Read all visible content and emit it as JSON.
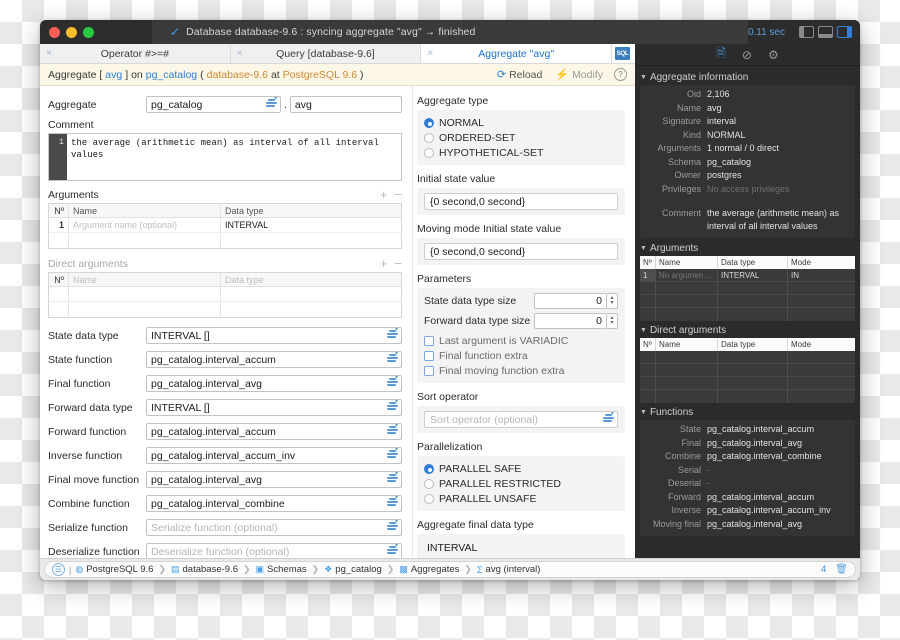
{
  "window": {
    "titlebar": {
      "status_icon": "check-icon",
      "status_text": "Database database-9.6 : syncing aggregate \"avg\" → finished",
      "elapsed": "0.11 sec"
    }
  },
  "tabs": [
    {
      "label": "Operator #>=#",
      "active": false,
      "close": "×"
    },
    {
      "label": "Query [database-9.6]",
      "active": false,
      "close": "×"
    },
    {
      "label": "Aggregate \"avg\"",
      "active": true,
      "close": "×",
      "badge": "SQL"
    }
  ],
  "subheader": {
    "prefix": "Aggregate [ ",
    "object": "avg",
    "mid": " ] on ",
    "schema": "pg_catalog",
    "paren_open": " (",
    "database": "database-9.6",
    "at": " at ",
    "server": "PostgreSQL 9.6",
    "paren_close": ")",
    "reload": "Reload",
    "modify": "Modify",
    "help": "?"
  },
  "form": {
    "aggregate_label": "Aggregate",
    "aggregate_schema": "pg_catalog",
    "dot": ".",
    "aggregate_name": "avg",
    "comment_label": "Comment",
    "comment_line_no": "1",
    "comment_text": "the average (arithmetic mean) as interval of all interval\nvalues",
    "arguments": {
      "title": "Arguments",
      "add": "+",
      "remove": "−",
      "columns": [
        "Nº",
        "Name",
        "Data type"
      ],
      "rows": [
        {
          "num": "1",
          "name_placeholder": "Argument name (optional)",
          "data_type": "INTERVAL"
        },
        {
          "num": "",
          "name_placeholder": "",
          "data_type": ""
        }
      ]
    },
    "direct_arguments": {
      "title": "Direct arguments",
      "add": "+",
      "remove": "−",
      "columns": [
        "Nº",
        "Name",
        "Data type"
      ],
      "rows": [
        {
          "num": "",
          "name_placeholder": "",
          "data_type": ""
        },
        {
          "num": "",
          "name_placeholder": "",
          "data_type": ""
        }
      ]
    },
    "fields": [
      {
        "label": "State data type",
        "value": "INTERVAL []",
        "placeholder": ""
      },
      {
        "label": "State function",
        "value": "pg_catalog.interval_accum",
        "placeholder": ""
      },
      {
        "label": "Final function",
        "value": "pg_catalog.interval_avg",
        "placeholder": ""
      },
      {
        "label": "Forward data type",
        "value": "INTERVAL []",
        "placeholder": ""
      },
      {
        "label": "Forward function",
        "value": "pg_catalog.interval_accum",
        "placeholder": ""
      },
      {
        "label": "Inverse function",
        "value": "pg_catalog.interval_accum_inv",
        "placeholder": ""
      },
      {
        "label": "Final move function",
        "value": "pg_catalog.interval_avg",
        "placeholder": ""
      },
      {
        "label": "Combine function",
        "value": "pg_catalog.interval_combine",
        "placeholder": ""
      },
      {
        "label": "Serialize function",
        "value": "",
        "placeholder": "Serialize function (optional)"
      },
      {
        "label": "Deserialize function",
        "value": "",
        "placeholder": "Deserialize function (optional)"
      }
    ]
  },
  "options": {
    "aggregate_type": {
      "label": "Aggregate type",
      "items": [
        {
          "label": "NORMAL",
          "selected": true
        },
        {
          "label": "ORDERED-SET",
          "selected": false
        },
        {
          "label": "HYPOTHETICAL-SET",
          "selected": false
        }
      ]
    },
    "initial_state": {
      "label": "Initial state value",
      "value": "{0 second,0 second}"
    },
    "moving_initial_state": {
      "label": "Moving mode Initial state value",
      "value": "{0 second,0 second}"
    },
    "parameters": {
      "label": "Parameters",
      "state_size": {
        "label": "State data type size",
        "value": "0"
      },
      "forward_size": {
        "label": "Forward data type size",
        "value": "0"
      },
      "checkboxes": [
        {
          "label": "Last argument is VARIADIC",
          "checked": false
        },
        {
          "label": "Final function extra",
          "checked": false
        },
        {
          "label": "Final moving function extra",
          "checked": false
        }
      ]
    },
    "sort_operator": {
      "label": "Sort operator",
      "placeholder": "Sort operator (optional)",
      "value": ""
    },
    "parallelization": {
      "label": "Parallelization",
      "items": [
        {
          "label": "PARALLEL SAFE",
          "selected": true
        },
        {
          "label": "PARALLEL RESTRICTED",
          "selected": false
        },
        {
          "label": "PARALLEL UNSAFE",
          "selected": false
        }
      ]
    },
    "final_data_type": {
      "label": "Aggregate final data type",
      "value": "INTERVAL"
    }
  },
  "inspector": {
    "toolbar_icons": [
      "document-icon",
      "help-icon",
      "gear-icon"
    ],
    "info": {
      "title": "Aggregate information",
      "rows": [
        {
          "key": "Oid",
          "value": "2,106"
        },
        {
          "key": "Name",
          "value": "avg"
        },
        {
          "key": "Signature",
          "value": "interval"
        },
        {
          "key": "Kind",
          "value": "NORMAL"
        },
        {
          "key": "Arguments",
          "value": "1 normal / 0 direct"
        },
        {
          "key": "Schema",
          "value": "pg_catalog"
        },
        {
          "key": "Owner",
          "value": "postgres"
        },
        {
          "key": "Privileges",
          "value": "No access privileges",
          "dim": true
        },
        {
          "key": "",
          "value": ""
        },
        {
          "key": "Comment",
          "value": "the average (arithmetic mean) as interval of all interval values"
        }
      ]
    },
    "arguments": {
      "title": "Arguments",
      "columns": [
        "Nº",
        "Name",
        "Data type",
        "Mode"
      ],
      "rows": [
        {
          "num": "1",
          "name": "No argumen…",
          "name_dim": true,
          "type": "INTERVAL",
          "mode": "IN"
        },
        {
          "num": "",
          "name": "",
          "type": "",
          "mode": ""
        },
        {
          "num": "",
          "name": "",
          "type": "",
          "mode": ""
        },
        {
          "num": "",
          "name": "",
          "type": "",
          "mode": ""
        }
      ]
    },
    "direct_arguments": {
      "title": "Direct arguments",
      "columns": [
        "Nº",
        "Name",
        "Data type",
        "Mode"
      ],
      "rows": [
        {
          "num": "",
          "name": "",
          "type": "",
          "mode": ""
        },
        {
          "num": "",
          "name": "",
          "type": "",
          "mode": ""
        },
        {
          "num": "",
          "name": "",
          "type": "",
          "mode": ""
        },
        {
          "num": "",
          "name": "",
          "type": "",
          "mode": ""
        }
      ]
    },
    "functions": {
      "title": "Functions",
      "rows": [
        {
          "key": "State",
          "value": "pg_catalog.interval_accum"
        },
        {
          "key": "Final",
          "value": "pg_catalog.interval_avg"
        },
        {
          "key": "Combine",
          "value": "pg_catalog.interval_combine"
        },
        {
          "key": "Serial",
          "value": "-",
          "dash": true
        },
        {
          "key": "Deserial",
          "value": "-",
          "dash": true
        },
        {
          "key": "Forward",
          "value": "pg_catalog.interval_accum"
        },
        {
          "key": "Inverse",
          "value": "pg_catalog.interval_accum_inv"
        },
        {
          "key": "Moving final",
          "value": "pg_catalog.interval_avg"
        }
      ]
    }
  },
  "statusbar": {
    "crumbs": [
      {
        "label": "PostgreSQL 9.6",
        "icon": "server-icon"
      },
      {
        "label": "database-9.6",
        "icon": "database-icon"
      },
      {
        "label": "Schemas",
        "icon": "schemas-icon"
      },
      {
        "label": "pg_catalog",
        "icon": "schema-icon"
      },
      {
        "label": "Aggregates",
        "icon": "aggregates-icon"
      },
      {
        "label": "avg (interval)",
        "icon": "sigma-icon"
      }
    ],
    "separator": "❯",
    "count": "4",
    "trash": "🗑"
  },
  "colors": {
    "accent_blue": "#2f7fd6",
    "link_blue": "#2a7fd4",
    "orange": "#d08a2e",
    "dark_panel": "#2b2b2b",
    "header_cream": "#fdf7e8"
  }
}
